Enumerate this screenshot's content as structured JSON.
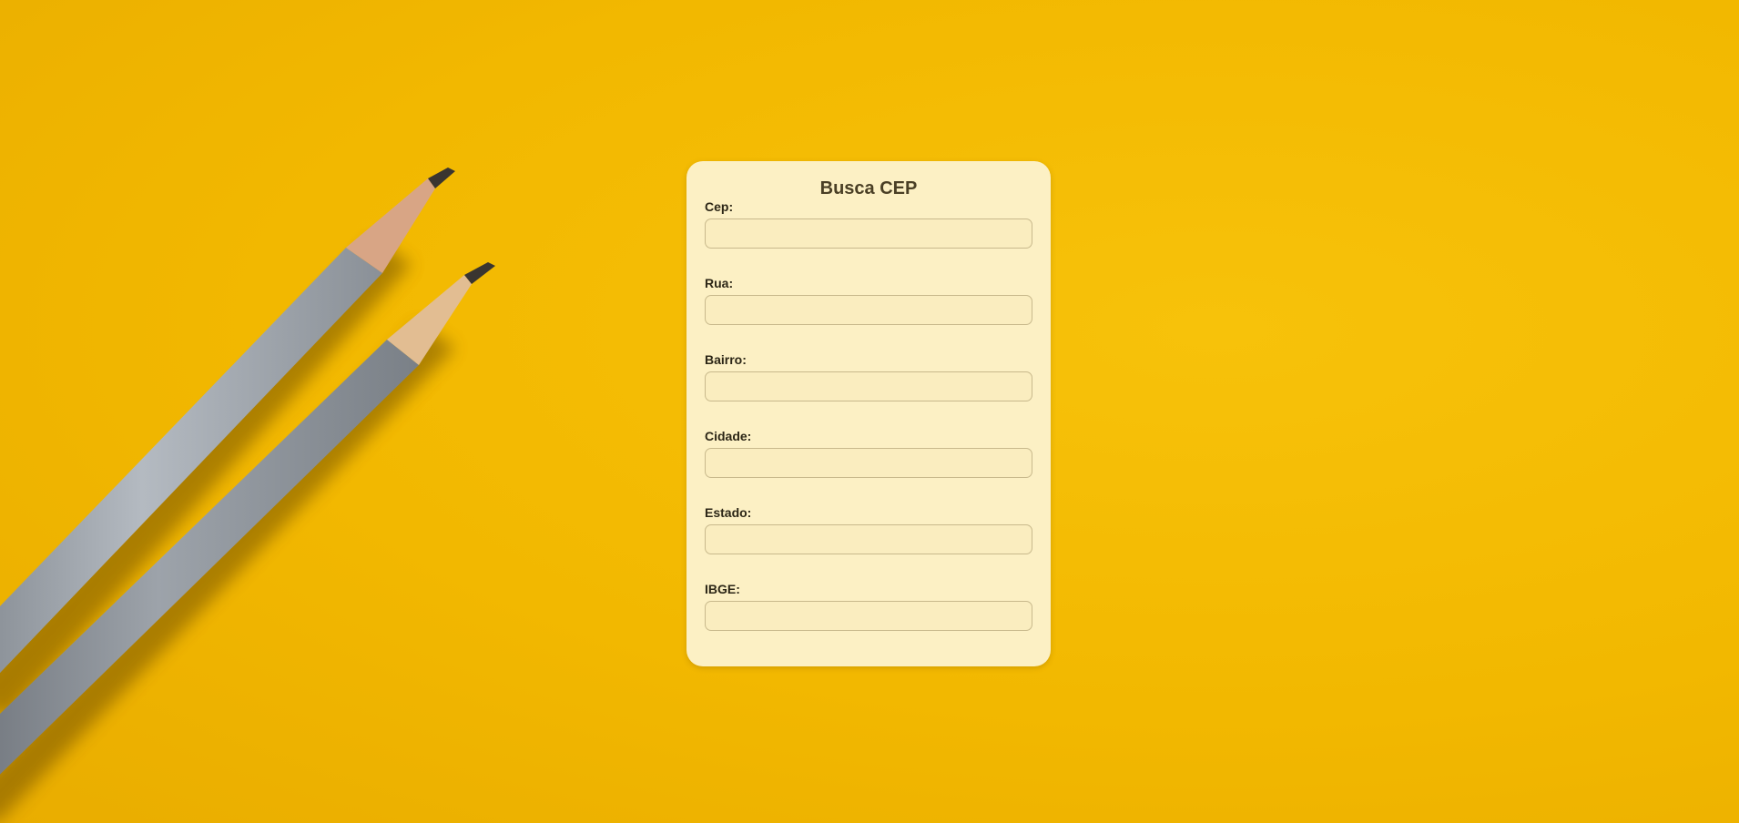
{
  "form": {
    "title": "Busca CEP",
    "fields": [
      {
        "label": "Cep:",
        "value": ""
      },
      {
        "label": "Rua:",
        "value": ""
      },
      {
        "label": "Bairro:",
        "value": ""
      },
      {
        "label": "Cidade:",
        "value": ""
      },
      {
        "label": "Estado:",
        "value": ""
      },
      {
        "label": "IBGE:",
        "value": ""
      }
    ]
  },
  "colors": {
    "background": "#f2b800",
    "card": "#fcf0c4",
    "input_border": "#c8b98c",
    "pencil_wood": "#e0b48c",
    "pencil_body_light": "#a9afb6",
    "pencil_body_dark": "#8d9299"
  },
  "background_image": "two-pencils-on-yellow-paper"
}
